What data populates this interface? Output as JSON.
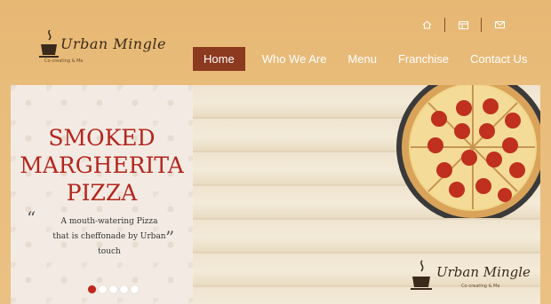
{
  "header": {
    "logo_text": "Urban Mingle",
    "logo_tagline": "Co-creating & Me",
    "icons": [
      "home-icon",
      "grid-icon",
      "mail-icon"
    ]
  },
  "nav": {
    "items": [
      {
        "label": "Home",
        "active": true
      },
      {
        "label": "Who We Are",
        "active": false
      },
      {
        "label": "Menu",
        "active": false
      },
      {
        "label": "Franchise",
        "active": false
      },
      {
        "label": "Contact Us",
        "active": false
      }
    ]
  },
  "slide": {
    "headline_1": "SMOKED",
    "headline_2": "MARGHERITA",
    "headline_3": "PIZZA",
    "quote_open": "“",
    "quote_close": "”",
    "desc_1": "A mouth-watering Pizza",
    "desc_2": "that is cheffonade by Urban touch",
    "logo_text": "Urban Mingle",
    "logo_tagline": "Co-creating & Me",
    "dots": 5,
    "active_dot": 1
  },
  "colors": {
    "background": "#e9bd7c",
    "nav_active": "#8b3a1f",
    "headline": "#b3261e"
  }
}
